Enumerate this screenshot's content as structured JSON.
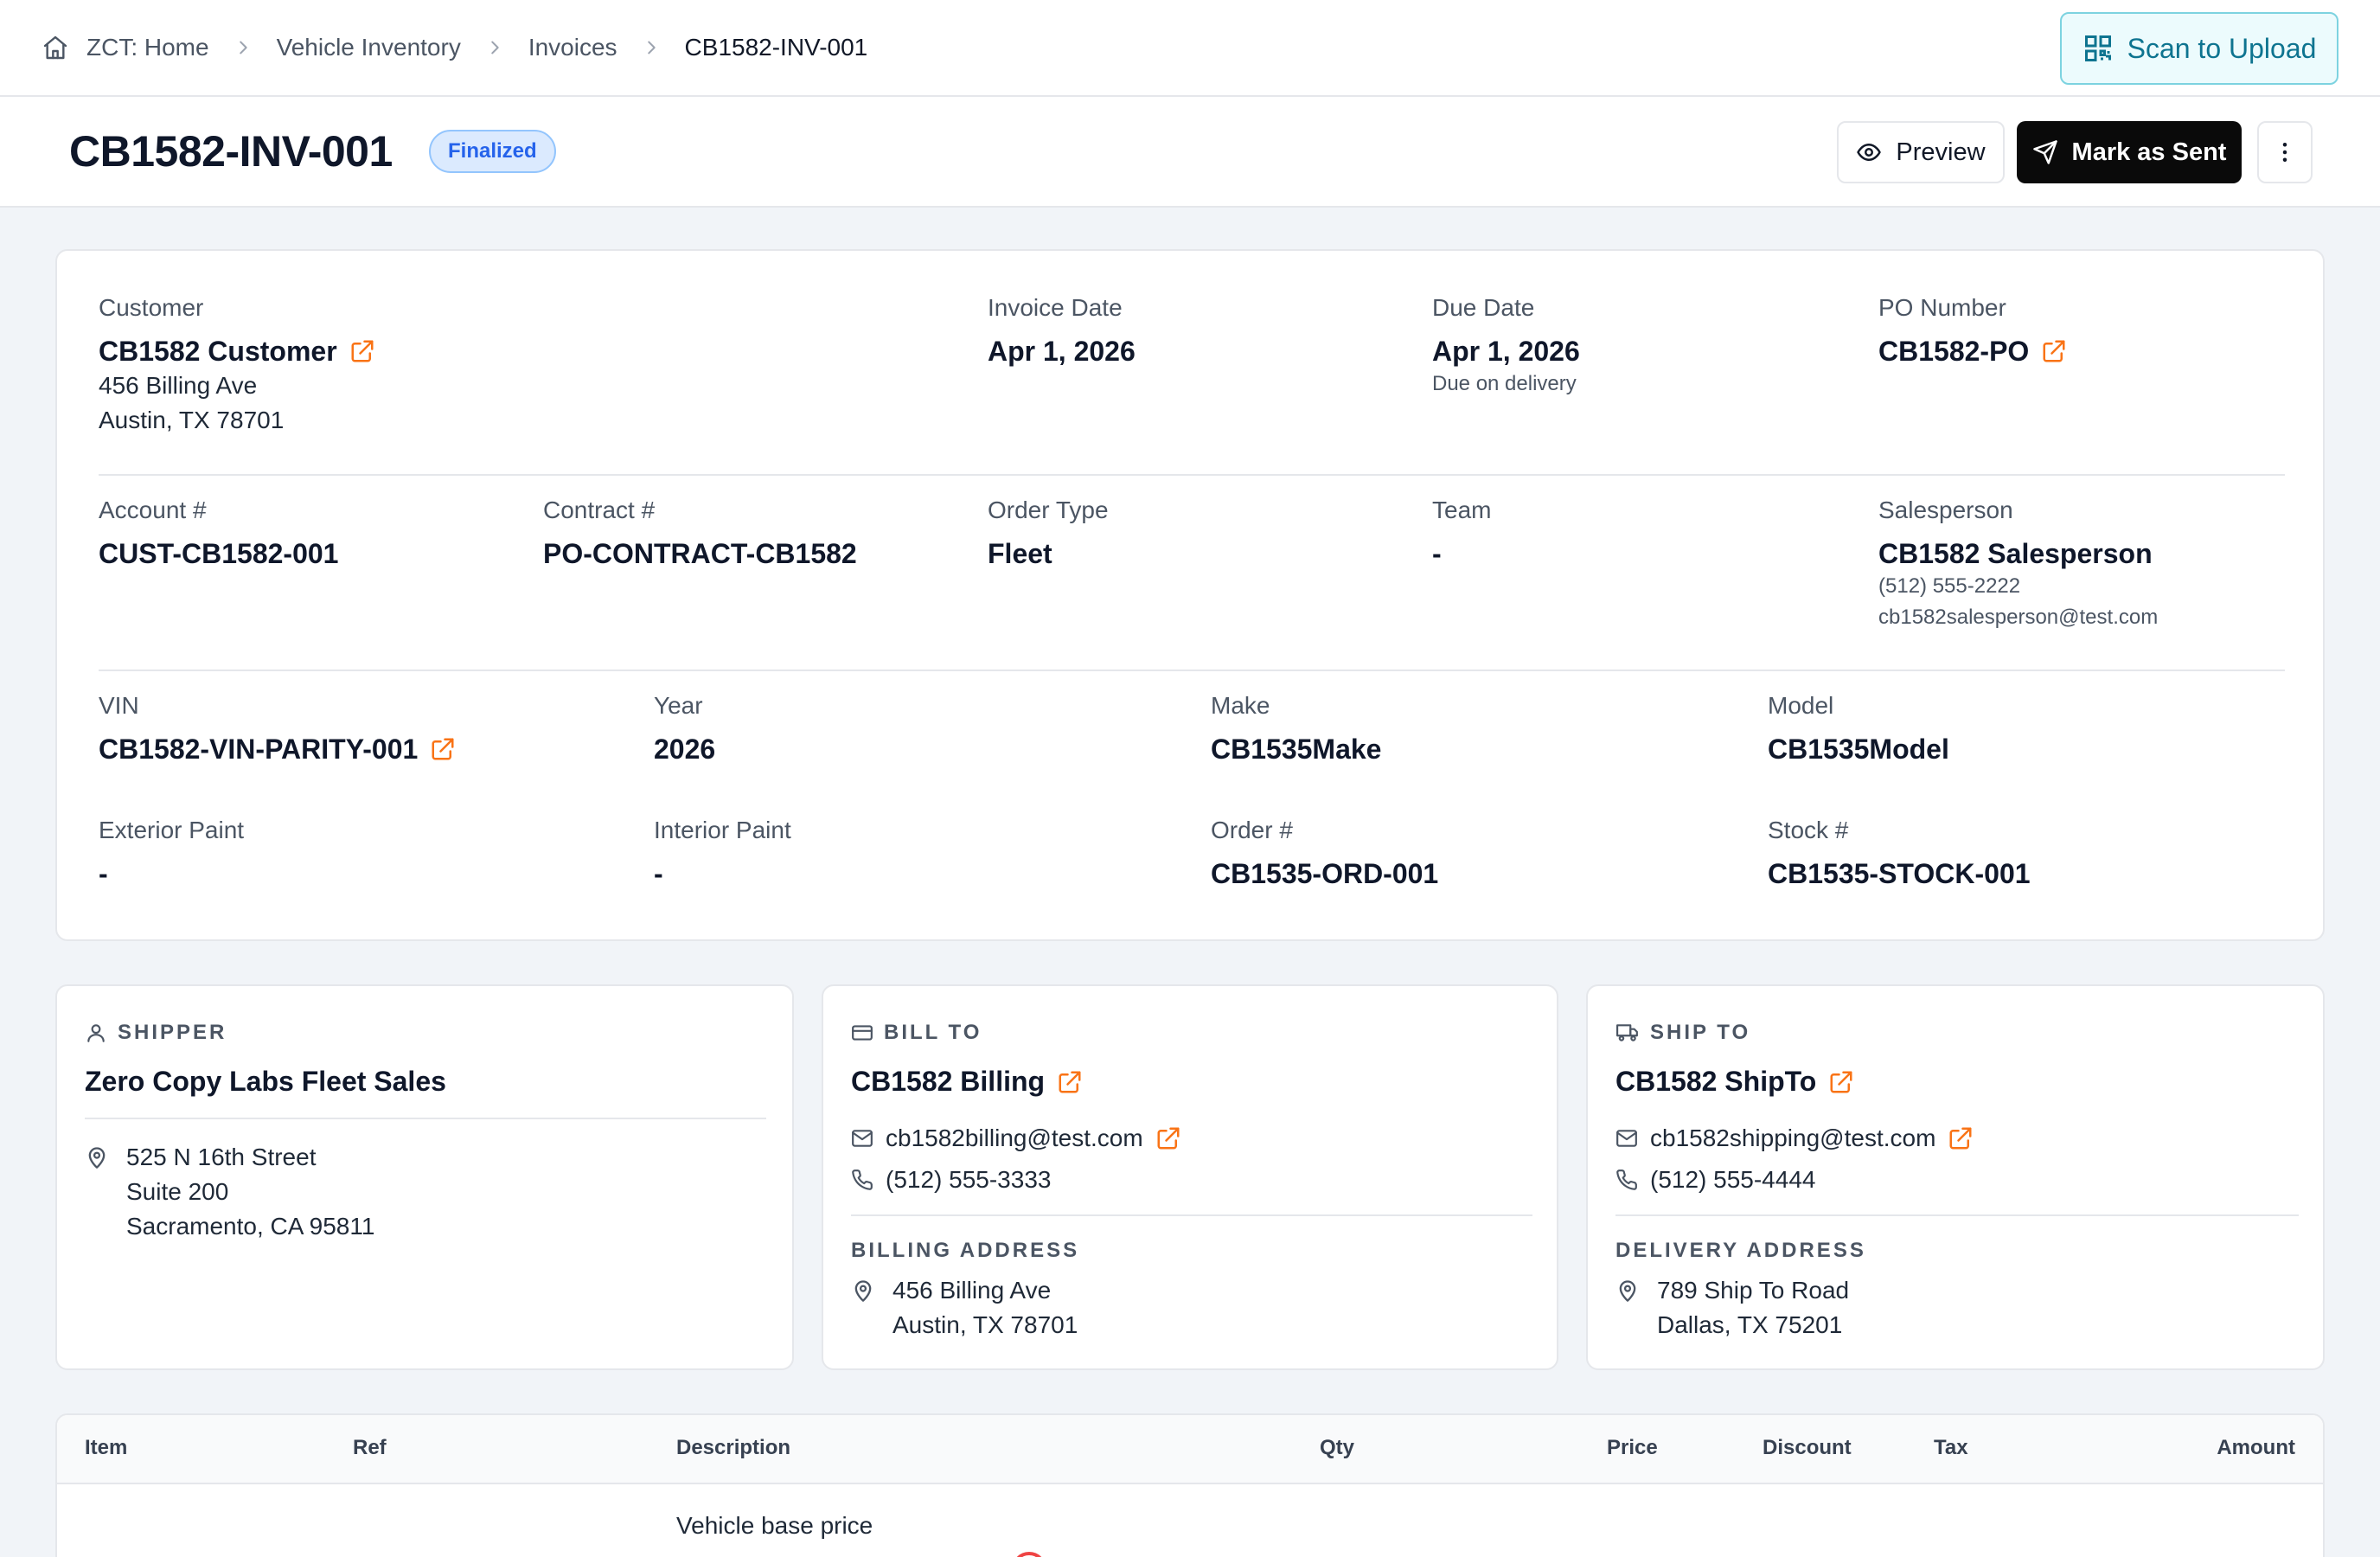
{
  "breadcrumb": {
    "items": [
      {
        "label": "ZCT: Home"
      },
      {
        "label": "Vehicle Inventory"
      },
      {
        "label": "Invoices"
      },
      {
        "label": "CB1582-INV-001"
      }
    ]
  },
  "toolbar": {
    "scan_label": "Scan to Upload"
  },
  "header": {
    "title": "CB1582-INV-001",
    "status": "Finalized",
    "preview_label": "Preview",
    "mark_sent_label": "Mark as Sent"
  },
  "invoice": {
    "customer": {
      "label": "Customer",
      "name": "CB1582 Customer",
      "addr1": "456 Billing Ave",
      "addr2": "Austin, TX 78701"
    },
    "invoice_date": {
      "label": "Invoice Date",
      "value": "Apr 1, 2026"
    },
    "due_date": {
      "label": "Due Date",
      "value": "Apr 1, 2026",
      "note": "Due on delivery"
    },
    "po_number": {
      "label": "PO Number",
      "value": "CB1582-PO"
    },
    "account": {
      "label": "Account #",
      "value": "CUST-CB1582-001"
    },
    "contract": {
      "label": "Contract #",
      "value": "PO-CONTRACT-CB1582"
    },
    "order_type": {
      "label": "Order Type",
      "value": "Fleet"
    },
    "team": {
      "label": "Team",
      "value": "-"
    },
    "salesperson": {
      "label": "Salesperson",
      "name": "CB1582 Salesperson",
      "phone": "(512) 555-2222",
      "email": "cb1582salesperson@test.com"
    },
    "vin": {
      "label": "VIN",
      "value": "CB1582-VIN-PARITY-001"
    },
    "year": {
      "label": "Year",
      "value": "2026"
    },
    "make": {
      "label": "Make",
      "value": "CB1535Make"
    },
    "model": {
      "label": "Model",
      "value": "CB1535Model"
    },
    "exterior_paint": {
      "label": "Exterior Paint",
      "value": "-"
    },
    "interior_paint": {
      "label": "Interior Paint",
      "value": "-"
    },
    "order_no": {
      "label": "Order #",
      "value": "CB1535-ORD-001"
    },
    "stock_no": {
      "label": "Stock #",
      "value": "CB1535-STOCK-001"
    }
  },
  "shipper": {
    "title": "SHIPPER",
    "name": "Zero Copy Labs Fleet Sales",
    "addr1": "525 N 16th Street",
    "addr2": "Suite 200",
    "addr3": "Sacramento, CA 95811"
  },
  "bill_to": {
    "title": "BILL TO",
    "name": "CB1582 Billing",
    "email": "cb1582billing@test.com",
    "phone": "(512) 555-3333",
    "addr_title": "BILLING ADDRESS",
    "addr1": "456 Billing Ave",
    "addr2": "Austin, TX 78701"
  },
  "ship_to": {
    "title": "SHIP TO",
    "name": "CB1582 ShipTo",
    "email": "cb1582shipping@test.com",
    "phone": "(512) 555-4444",
    "addr_title": "DELIVERY ADDRESS",
    "addr1": "789 Ship To Road",
    "addr2": "Dallas, TX 75201"
  },
  "line_items": {
    "columns": [
      "Item",
      "Ref",
      "Description",
      "Qty",
      "Price",
      "Discount",
      "Tax",
      "Amount"
    ],
    "rows": [
      {
        "description": "Vehicle base price"
      }
    ]
  },
  "colors": {
    "accent_link": "#f97316",
    "badge": "#2563eb",
    "scan": "#0e7490"
  }
}
